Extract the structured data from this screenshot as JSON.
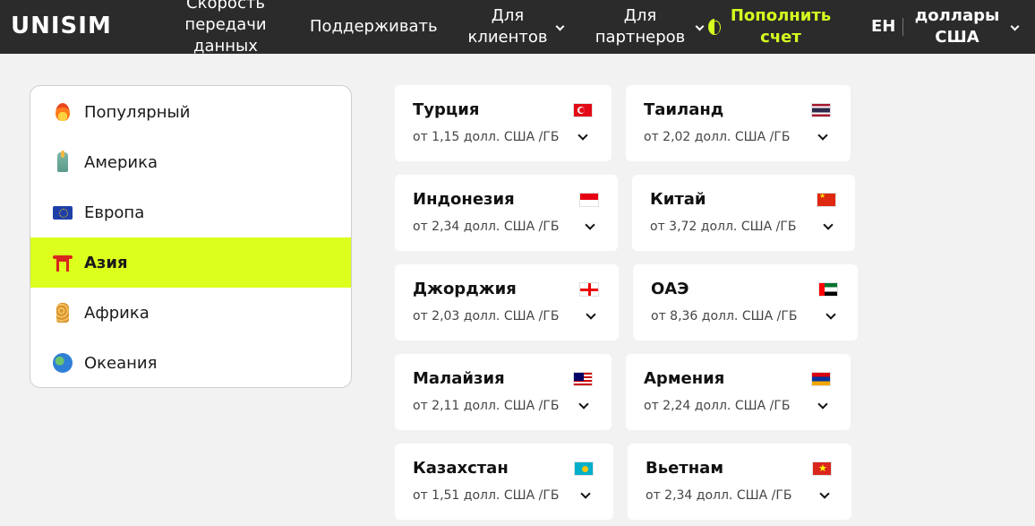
{
  "header": {
    "logo": "UNISIM",
    "nav": {
      "speed": "Скорость передачи данных",
      "support": "Поддерживать",
      "clients": "Для клиентов",
      "partners": "Для партнеров",
      "topup": "Пополнить счет",
      "lang": "EH",
      "currency": "доллары США"
    },
    "accent_color": "#d4ff1f",
    "background_color": "#2b2b2b"
  },
  "sidebar": {
    "items": [
      {
        "label": "Популярный",
        "icon": "fire-icon",
        "active": false
      },
      {
        "label": "Америка",
        "icon": "statue-of-liberty-icon",
        "active": false
      },
      {
        "label": "Европа",
        "icon": "eu-flag-icon",
        "active": false
      },
      {
        "label": "Азия",
        "icon": "torii-gate-icon",
        "active": true
      },
      {
        "label": "Африка",
        "icon": "giraffe-icon",
        "active": false
      },
      {
        "label": "Океания",
        "icon": "globe-icon",
        "active": false
      }
    ],
    "active_color": "#dcff1e"
  },
  "countries": [
    {
      "name": "Турция",
      "price": "от 1,15 долл. США /ГБ",
      "flag": "turkey-flag-icon"
    },
    {
      "name": "Таиланд",
      "price": "от 2,02 долл. США /ГБ",
      "flag": "thailand-flag-icon"
    },
    {
      "name": "Индонезия",
      "price": "от 2,34 долл. США /ГБ",
      "flag": "indonesia-flag-icon"
    },
    {
      "name": "Китай",
      "price": "от 3,72 долл. США /ГБ",
      "flag": "china-flag-icon"
    },
    {
      "name": "Джорджия",
      "price": "от 2,03 долл. США /ГБ",
      "flag": "georgia-flag-icon"
    },
    {
      "name": "ОАЭ",
      "price": "от 8,36 долл. США /ГБ",
      "flag": "uae-flag-icon"
    },
    {
      "name": "Малайзия",
      "price": "от 2,11 долл. США /ГБ",
      "flag": "malaysia-flag-icon"
    },
    {
      "name": "Армения",
      "price": "от 2,24 долл. США /ГБ",
      "flag": "armenia-flag-icon"
    },
    {
      "name": "Казахстан",
      "price": "от 1,51 долл. США /ГБ",
      "flag": "kazakhstan-flag-icon"
    },
    {
      "name": "Вьетнам",
      "price": "от 2,34 долл. США /ГБ",
      "flag": "vietnam-flag-icon"
    }
  ]
}
